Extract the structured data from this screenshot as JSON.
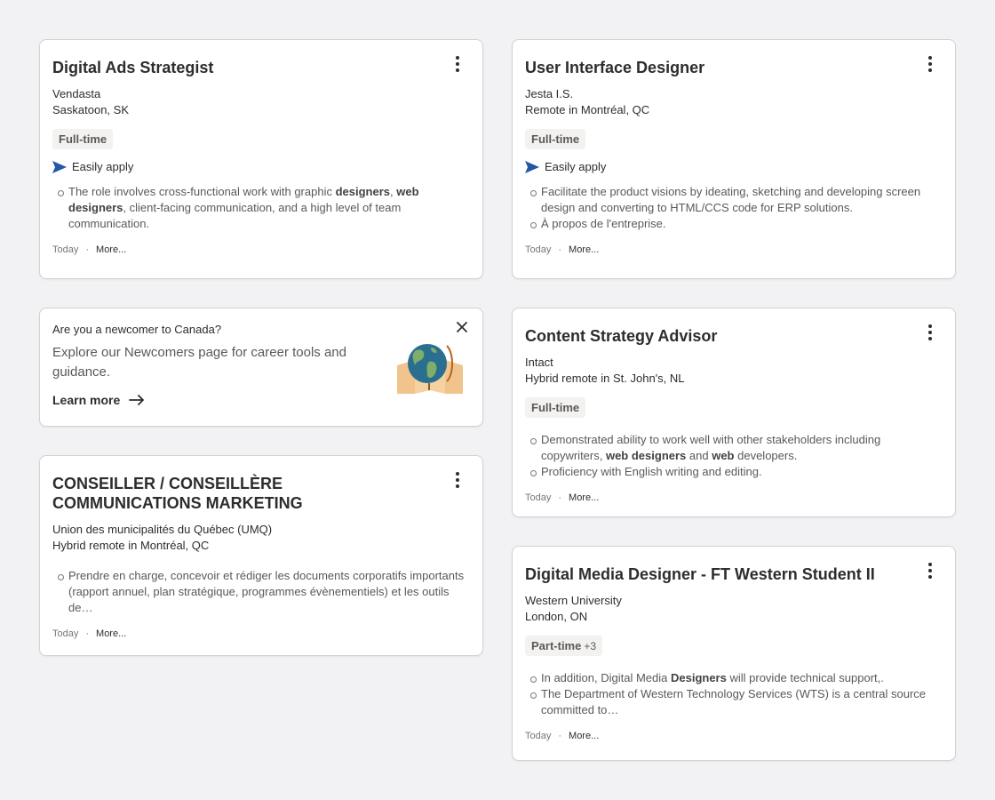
{
  "jobs": {
    "ads": {
      "title": "Digital Ads Strategist",
      "company": "Vendasta",
      "location": "Saskatoon, SK",
      "badge": "Full-time",
      "easy_apply": "Easily apply",
      "bullets": [
        [
          {
            "t": "The role involves cross-functional work with graphic "
          },
          {
            "t": "designers",
            "b": true
          },
          {
            "t": ", "
          },
          {
            "t": "web designers",
            "b": true
          },
          {
            "t": ", client-facing communication, and a high level of team communication."
          }
        ]
      ],
      "posted": "Today",
      "more": "More..."
    },
    "ui": {
      "title": "User Interface Designer",
      "company": "Jesta I.S.",
      "location": "Remote in Montréal, QC",
      "badge": "Full-time",
      "easy_apply": "Easily apply",
      "bullets": [
        [
          {
            "t": "Facilitate the product visions by ideating, sketching and developing screen design and converting to HTML/CCS code for ERP solutions."
          }
        ],
        [
          {
            "t": "À propos de l'entreprise."
          }
        ]
      ],
      "posted": "Today",
      "more": "More..."
    },
    "conseiller": {
      "title": "CONSEILLER / CONSEILLÈRE COMMUNICATIONS MARKETING",
      "company": "Union des municipalités du Québec (UMQ)",
      "location": "Hybrid remote in Montréal, QC",
      "bullets": [
        [
          {
            "t": "Prendre en charge, concevoir et rédiger les documents corporatifs importants (rapport annuel, plan stratégique, programmes évènementiels) et les outils de…"
          }
        ]
      ],
      "posted": "Today",
      "more": "More..."
    },
    "content": {
      "title": "Content Strategy Advisor",
      "company": "Intact",
      "location": "Hybrid remote in St. John's, NL",
      "badge": "Full-time",
      "bullets": [
        [
          {
            "t": "Demonstrated ability to work well with other stakeholders including copywriters, "
          },
          {
            "t": "web designers",
            "b": true
          },
          {
            "t": " and "
          },
          {
            "t": "web",
            "b": true
          },
          {
            "t": " developers."
          }
        ],
        [
          {
            "t": "Proficiency with English writing and editing."
          }
        ]
      ],
      "posted": "Today",
      "more": "More..."
    },
    "media": {
      "title": "Digital Media Designer - FT Western Student II",
      "company": "Western University",
      "location": "London, ON",
      "badge": "Part-time",
      "badge_extra": "+3",
      "bullets": [
        [
          {
            "t": "In addition, Digital Media "
          },
          {
            "t": "Designers",
            "b": true
          },
          {
            "t": " will provide technical support,."
          }
        ],
        [
          {
            "t": "The Department of Western Technology Services (WTS) is a central source committed to…"
          }
        ]
      ],
      "posted": "Today",
      "more": "More..."
    }
  },
  "promo": {
    "question": "Are you a newcomer to Canada?",
    "text": "Explore our Newcomers page for career tools and guidance.",
    "link": "Learn more"
  },
  "colors": {
    "background": "#f2f2f4",
    "easy_apply_icon": "#2557a7",
    "globe_ocean": "#2a6f8f",
    "globe_land": "#7fae6a",
    "map_paper": "#f0c48c"
  }
}
